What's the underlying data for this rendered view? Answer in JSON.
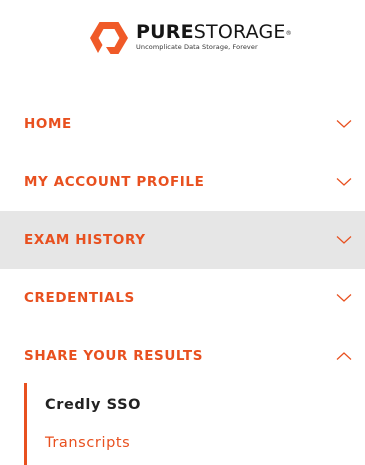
{
  "brand": {
    "name_bold": "PURE",
    "name_light": "STORAGE",
    "registered": "®",
    "tagline": "Uncomplicate Data Storage, Forever",
    "accent_color": "#e8501f"
  },
  "nav": {
    "items": [
      {
        "label": "HOME",
        "icon": "chevron-down-icon"
      },
      {
        "label": "MY ACCOUNT PROFILE",
        "icon": "chevron-down-icon"
      },
      {
        "label": "EXAM HISTORY",
        "icon": "chevron-down-icon",
        "highlighted": true
      },
      {
        "label": "CREDENTIALS",
        "icon": "chevron-down-icon"
      },
      {
        "label": "SHARE YOUR RESULTS",
        "icon": "chevron-up-icon",
        "expanded": true
      }
    ],
    "submenu": [
      {
        "label": "Credly SSO",
        "current": true
      },
      {
        "label": "Transcripts"
      }
    ]
  }
}
